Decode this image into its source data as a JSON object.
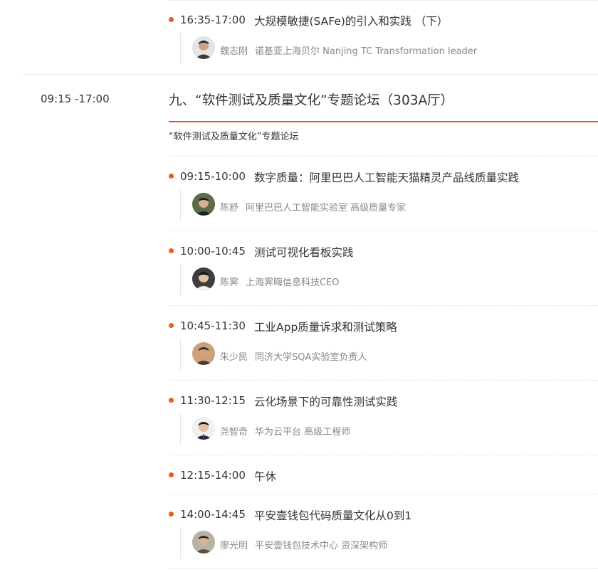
{
  "prev": {
    "time": "16:35-17:00",
    "title": "大规模敏捷(SAFe)的引入和实践 （下）",
    "speaker": {
      "name": "魏志刚",
      "org": "诺基亚上海贝尔 Nanjing TC Transformation leader"
    }
  },
  "session": {
    "time": "09:15 -17:00",
    "title": "九、“软件测试及质量文化”专题论坛（303A厅）",
    "subtitle": "“软件测试及质量文化”专题论坛",
    "accent_color": "#e65a1e"
  },
  "items": [
    {
      "time": "09:15-10:00",
      "title": "数字质量：阿里巴巴人工智能天猫精灵产品线质量实践",
      "speaker": {
        "name": "陈舒",
        "org": "阿里巴巴人工智能实验室 高级质量专家"
      }
    },
    {
      "time": "10:00-10:45",
      "title": "测试可视化看板实践",
      "speaker": {
        "name": "陈霁",
        "org": "上海霁晦信息科技CEO"
      }
    },
    {
      "time": "10:45-11:30",
      "title": "工业App质量诉求和测试策略",
      "speaker": {
        "name": "朱少民",
        "org": "同济大学SQA实验室负责人"
      }
    },
    {
      "time": "11:30-12:15",
      "title": "云化场景下的可靠性测试实践",
      "speaker": {
        "name": "尧智奇",
        "org": "华为云平台 高级工程师"
      }
    },
    {
      "time": "12:15-14:00",
      "title": "午休"
    },
    {
      "time": "14:00-14:45",
      "title": "平安壹钱包代码质量文化从0到1",
      "speaker": {
        "name": "廖光明",
        "org": "平安壹钱包技术中心 资深架构师"
      }
    }
  ]
}
